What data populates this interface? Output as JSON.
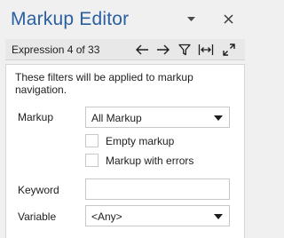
{
  "window": {
    "title": "Markup Editor",
    "pane_options_icon": "dropdown-arrow-icon",
    "close_icon": "close-icon"
  },
  "toolbar": {
    "counter": "Expression 4 of 33",
    "buttons": [
      {
        "icon": "arrow-left-icon"
      },
      {
        "icon": "arrow-right-icon"
      },
      {
        "icon": "filter-icon"
      },
      {
        "icon": "fit-width-icon"
      },
      {
        "icon": "expand-icon"
      }
    ]
  },
  "filters": {
    "description": "These filters will be applied to markup navigation.",
    "markup": {
      "label": "Markup",
      "selected": "All Markup"
    },
    "options": [
      {
        "label": "Empty markup",
        "checked": false
      },
      {
        "label": "Markup with errors",
        "checked": false
      }
    ],
    "keyword": {
      "label": "Keyword",
      "value": "",
      "placeholder": ""
    },
    "variable": {
      "label": "Variable",
      "selected": "<Any>"
    }
  },
  "colors": {
    "title": "#2a5fa0",
    "background": "#f0f0f0",
    "panel": "#ffffff",
    "border": "#c8c8c8"
  }
}
